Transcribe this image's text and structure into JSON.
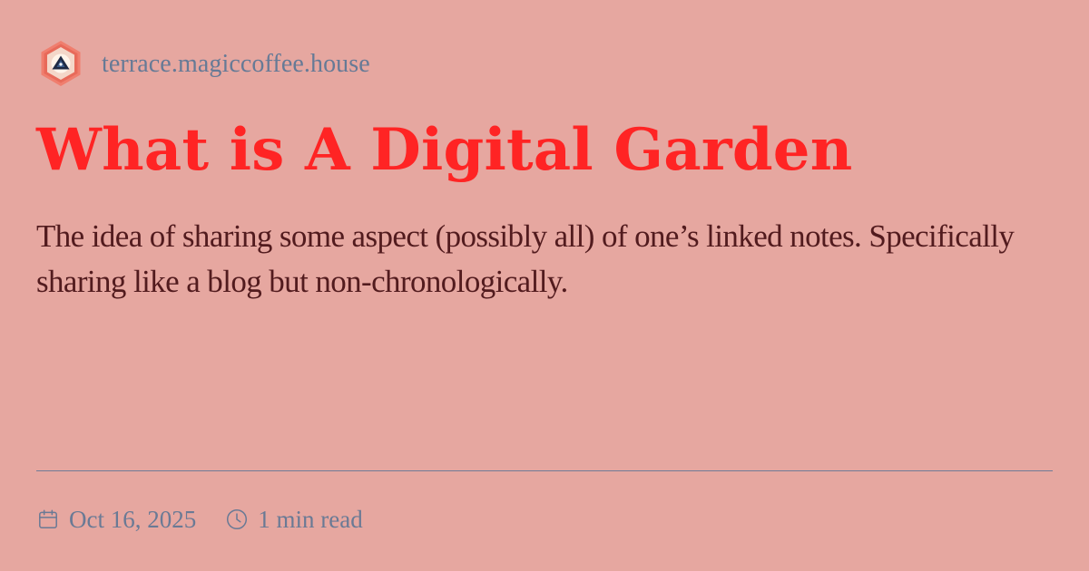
{
  "site": {
    "name": "terrace.magiccoffee.house",
    "logo_icon": "hexagon-logo-icon"
  },
  "post": {
    "title": "What is A Digital Garden",
    "description": "The idea of sharing some aspect (possibly all) of one’s linked notes. Specifically sharing like a blog but non-chronologically."
  },
  "meta": {
    "date": "Oct 16, 2025",
    "date_icon": "calendar-icon",
    "read_time": "1 min read",
    "read_time_icon": "clock-icon"
  },
  "colors": {
    "background": "#e6a7a0",
    "title": "#ff2424",
    "description": "#521b1e",
    "muted": "#667a96"
  }
}
